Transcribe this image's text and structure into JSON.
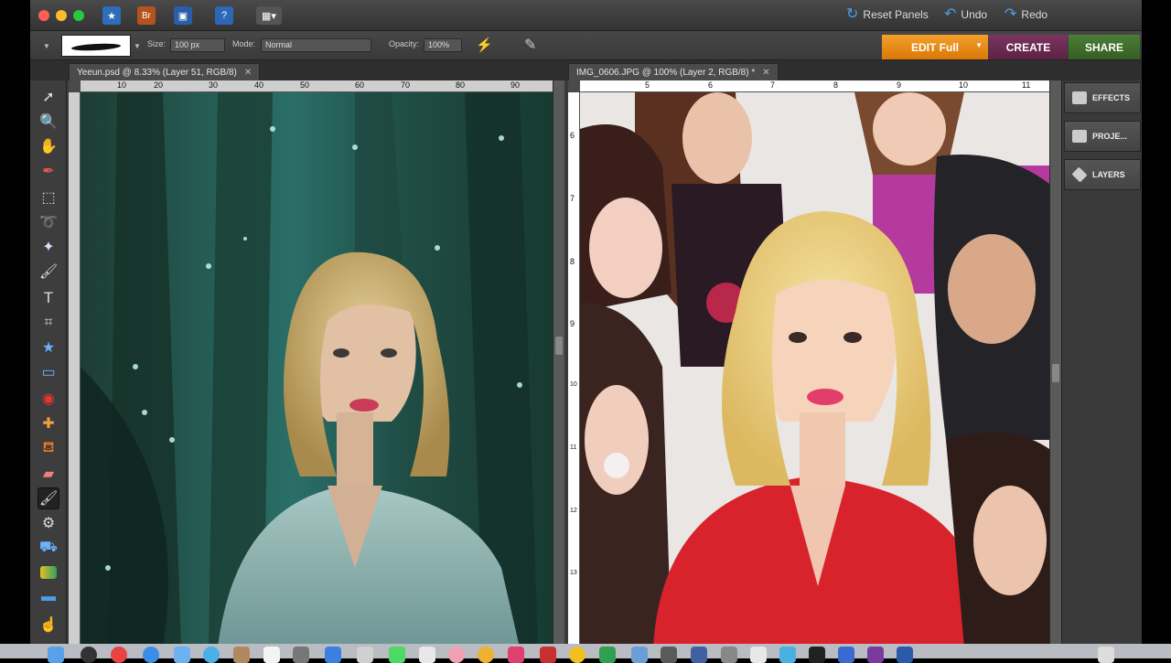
{
  "app": {
    "top_actions": {
      "reset_panels": "Reset Panels",
      "undo": "Undo",
      "redo": "Redo"
    },
    "options": {
      "size_label": "Size:",
      "size_value": "100 px",
      "mode_label": "Mode:",
      "mode_value": "Normal",
      "opacity_label": "Opacity:",
      "opacity_value": "100%"
    },
    "mode_buttons": {
      "edit": "EDIT Full",
      "create": "CREATE",
      "share": "SHARE"
    },
    "colors": {
      "edit": "#e8860e",
      "create": "#6e2a52",
      "share": "#3e6e2c"
    },
    "tabs": [
      {
        "label": "Yeeun.psd @ 8.33% (Layer 51, RGB/8)"
      },
      {
        "label": "IMG_0606.JPG @ 100% (Layer 2, RGB/8) *"
      }
    ],
    "panels": [
      {
        "label": "EFFECTS",
        "icon": "effects-icon"
      },
      {
        "label": "PROJE...",
        "icon": "project-bin-icon"
      },
      {
        "label": "LAYERS",
        "icon": "layers-icon"
      }
    ],
    "ruler_left": [
      "10",
      "20",
      "30",
      "40",
      "50",
      "60",
      "70",
      "80",
      "90"
    ],
    "ruler_right_h": [
      "5",
      "6",
      "7",
      "8",
      "9",
      "10",
      "11"
    ],
    "ruler_right_v": [
      "6",
      "7",
      "8",
      "9",
      "10",
      "11",
      "12",
      "13"
    ]
  }
}
